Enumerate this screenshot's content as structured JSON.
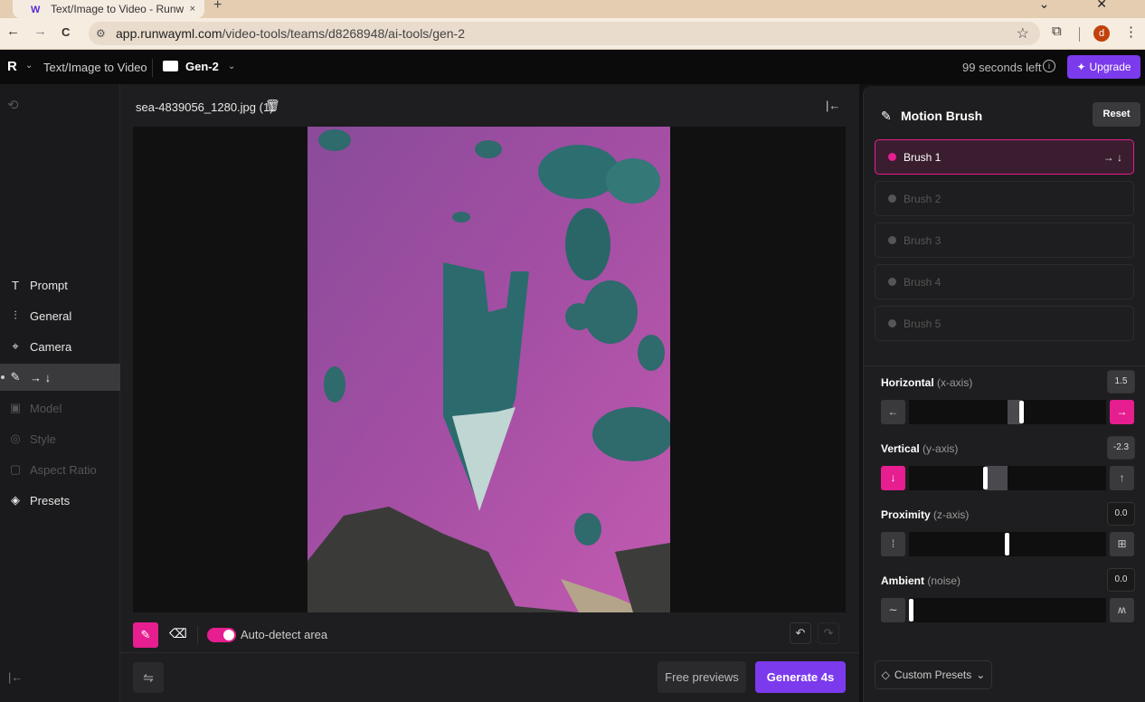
{
  "browser": {
    "tab_title": "Text/Image to Video - Runw",
    "tab_close": "×",
    "new_tab": "+",
    "window_controls": "⌄ ✕",
    "back": "←",
    "forward": "→",
    "reload": "C",
    "url_host": "app.runwayml.com",
    "url_path": "/video-tools/teams/d8268948/ai-tools/gen-2",
    "profile_initial": "d",
    "star": "☆",
    "ext": "⧉",
    "menu": "⋮"
  },
  "appbar": {
    "logo": "R",
    "app_name": "Text/Image to Video",
    "project_name": "Gen-2",
    "time_left": "99 seconds left",
    "info": "i",
    "upgrade_label": "Upgrade",
    "upgrade_icon": "✦"
  },
  "sidebar": {
    "reset_icon": "⟲",
    "items": [
      {
        "icon": "T",
        "label": "Prompt",
        "state": "normal"
      },
      {
        "icon": "⫶",
        "label": "General",
        "state": "normal"
      },
      {
        "icon": "⌖",
        "label": "Camera",
        "state": "normal"
      },
      {
        "icon": "✎",
        "label": "→ ↓",
        "state": "active"
      },
      {
        "icon": "▣",
        "label": "Model",
        "state": "dim"
      },
      {
        "icon": "◎",
        "label": "Style",
        "state": "dim"
      },
      {
        "icon": "▢",
        "label": "Aspect Ratio",
        "state": "dim"
      },
      {
        "icon": "◈",
        "label": "Presets",
        "state": "normal"
      }
    ],
    "collapse_icon": "|←"
  },
  "center": {
    "filename": "sea-4839056_1280.jpg (1)",
    "trash_icon": "🗑",
    "collapse_icon": "|←",
    "brush_tool_icon": "✎",
    "eraser_icon": "⌫",
    "auto_detect_label": "Auto-detect area",
    "auto_detect_on": true,
    "undo": "↶",
    "redo": "↷",
    "settings_icon": "⇋",
    "free_previews": "Free previews",
    "generate": "Generate 4s"
  },
  "motion_brush": {
    "title": "Motion Brush",
    "icon": "✎",
    "reset": "Reset",
    "brushes": [
      {
        "label": "Brush 1",
        "active": true,
        "dirs": "→ ↓"
      },
      {
        "label": "Brush 2",
        "active": false,
        "dirs": ""
      },
      {
        "label": "Brush 3",
        "active": false,
        "dirs": ""
      },
      {
        "label": "Brush 4",
        "active": false,
        "dirs": ""
      },
      {
        "label": "Brush 5",
        "active": false,
        "dirs": ""
      }
    ],
    "axes": {
      "horizontal": {
        "label": "Horizontal",
        "sub": "(x-axis)",
        "value": "1.5",
        "left_icon": "←",
        "right_icon": "→"
      },
      "vertical": {
        "label": "Vertical",
        "sub": "(y-axis)",
        "value": "-2.3",
        "left_icon": "↓",
        "right_icon": "↑"
      },
      "proximity": {
        "label": "Proximity",
        "sub": "(z-axis)",
        "value": "0.0",
        "left_icon": "⁞",
        "right_icon": "⊞"
      },
      "ambient": {
        "label": "Ambient",
        "sub": "(noise)",
        "value": "0.0",
        "left_icon": "∼",
        "right_icon": "ʍ"
      }
    },
    "custom_presets": "Custom Presets"
  },
  "colors": {
    "accent_pink": "#e61e8f",
    "accent_purple": "#7c3aed"
  }
}
